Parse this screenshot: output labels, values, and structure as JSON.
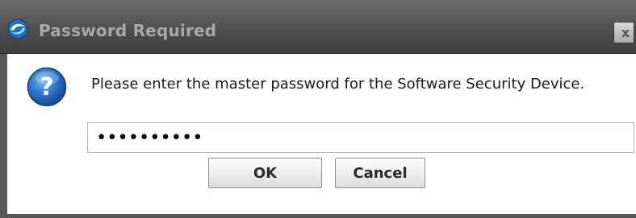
{
  "dialog": {
    "title": "Password Required",
    "message": "Please enter the master password for the Software Security Device.",
    "password": {
      "value": "••••••••••",
      "masked": true
    },
    "buttons": {
      "ok_label": "OK",
      "cancel_label": "Cancel"
    },
    "close_label": "x",
    "icons": {
      "title": "app-logo-icon",
      "message": "question-icon",
      "close": "close-icon"
    }
  }
}
